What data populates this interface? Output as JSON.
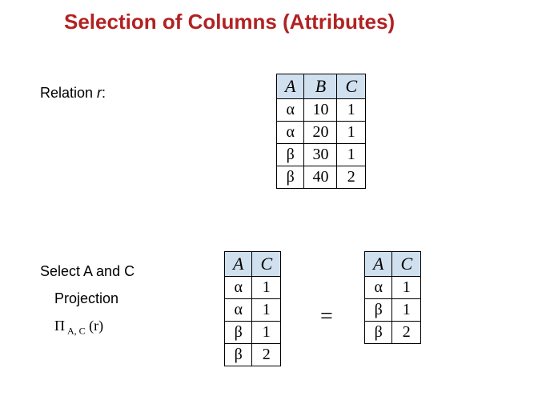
{
  "title": "Selection of Columns (Attributes)",
  "relation_label_prefix": "Relation ",
  "relation_label_name": "r",
  "relation_label_suffix": ":",
  "bottom": {
    "line1": "Select A and C",
    "line2": "Projection",
    "line3_pi": "Π",
    "line3_sub": " A, C",
    "line3_arg": " (r)"
  },
  "equals": "=",
  "table1": {
    "headers": [
      "A",
      "B",
      "C"
    ],
    "rows": [
      [
        "α",
        "10",
        "1"
      ],
      [
        "α",
        "20",
        "1"
      ],
      [
        "β",
        "30",
        "1"
      ],
      [
        "β",
        "40",
        "2"
      ]
    ]
  },
  "table2": {
    "headers": [
      "A",
      "C"
    ],
    "rows": [
      [
        "α",
        "1"
      ],
      [
        "α",
        "1"
      ],
      [
        "β",
        "1"
      ],
      [
        "β",
        "2"
      ]
    ]
  },
  "table3": {
    "headers": [
      "A",
      "C"
    ],
    "rows": [
      [
        "α",
        "1"
      ],
      [
        "β",
        "1"
      ],
      [
        "β",
        "2"
      ]
    ]
  }
}
